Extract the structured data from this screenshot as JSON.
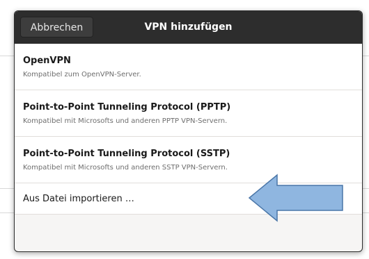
{
  "dialog": {
    "cancel_label": "Abbrechen",
    "title": "VPN hinzufügen"
  },
  "options": [
    {
      "title": "OpenVPN",
      "subtitle": "Kompatibel zum OpenVPN-Server."
    },
    {
      "title": "Point-to-Point Tunneling Protocol (PPTP)",
      "subtitle": "Kompatibel mit Microsofts und anderen PPTP VPN-Servern."
    },
    {
      "title": "Point-to-Point Tunneling Protocol (SSTP)",
      "subtitle": "Kompatibel mit Microsofts und anderen SSTP VPN-Servern."
    },
    {
      "title": "Aus Datei importieren …"
    }
  ],
  "annotation": {
    "arrow_color": "#8fb6e0",
    "arrow_outline": "#4a76a8"
  }
}
